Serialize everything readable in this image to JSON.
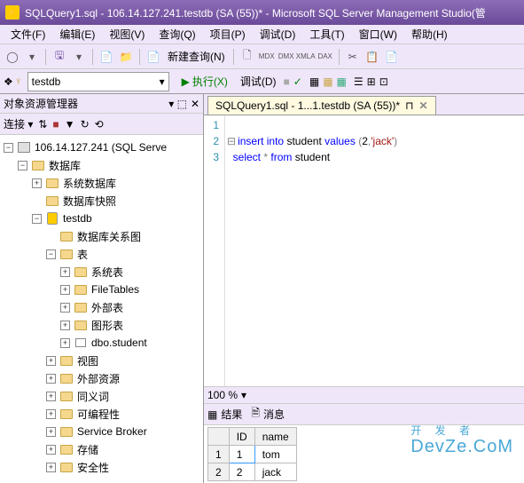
{
  "title": "SQLQuery1.sql - 106.14.127.241.testdb (SA (55))* - Microsoft SQL Server Management Studio(管",
  "menu": [
    "文件(F)",
    "编辑(E)",
    "视图(V)",
    "查询(Q)",
    "项目(P)",
    "调试(D)",
    "工具(T)",
    "窗口(W)",
    "帮助(H)"
  ],
  "toolbar": {
    "new_query": "新建查询(N)"
  },
  "toolbar2": {
    "db_selected": "testdb",
    "execute": "执行(X)",
    "debug": "调试(D)"
  },
  "explorer": {
    "title": "对象资源管理器",
    "connect_label": "连接 ▾",
    "server": "106.14.127.241 (SQL Serve",
    "nodes": {
      "databases": "数据库",
      "sys_db": "系统数据库",
      "db_snapshot": "数据库快照",
      "testdb": "testdb",
      "db_diagram": "数据库关系图",
      "tables": "表",
      "sys_tables": "系统表",
      "filetables": "FileTables",
      "ext_tables": "外部表",
      "graph_tables": "图形表",
      "dbo_student": "dbo.student",
      "views": "视图",
      "ext_res": "外部资源",
      "synonyms": "同义词",
      "programmability": "可编程性",
      "service_broker": "Service Broker",
      "storage": "存储",
      "security": "安全性"
    }
  },
  "editor": {
    "tab_label": "SQLQuery1.sql - 1...1.testdb (SA (55))*",
    "lines": [
      "1",
      "2",
      "3"
    ],
    "code": {
      "l2_insert": "insert",
      "l2_into": "into",
      "l2_obj": "student",
      "l2_values": "values",
      "l2_paren_open": "(",
      "l2_num": "2",
      "l2_comma": ",",
      "l2_str": "'jack'",
      "l2_paren_close": ")",
      "l3_select": "select",
      "l3_star": "*",
      "l3_from": "from",
      "l3_obj": "student"
    },
    "zoom": "100 %"
  },
  "results": {
    "tab_result": "结果",
    "tab_messages": "消息",
    "columns": [
      "",
      "ID",
      "name"
    ],
    "rows": [
      {
        "n": "1",
        "id": "1",
        "name": "tom"
      },
      {
        "n": "2",
        "id": "2",
        "name": "jack"
      }
    ]
  },
  "watermark": {
    "cn": "开 发 者",
    "en": "DevZe.CoM"
  }
}
